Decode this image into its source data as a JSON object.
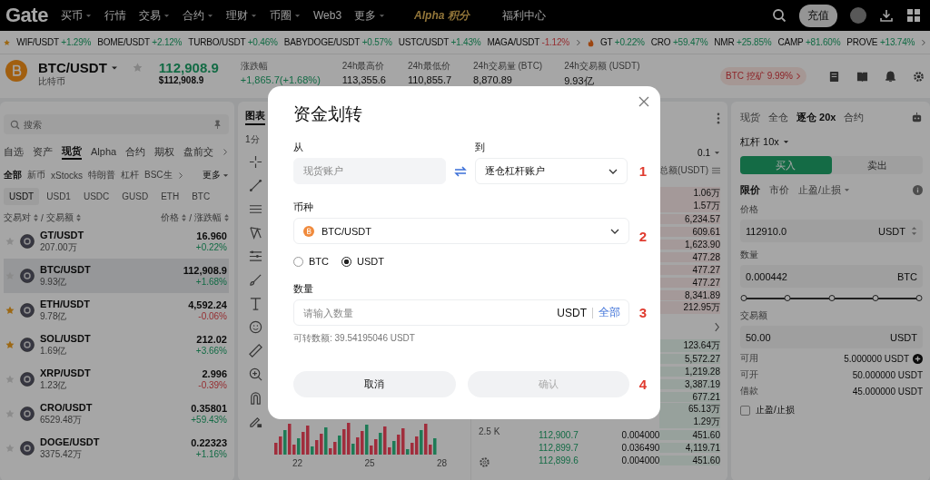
{
  "nav": {
    "logo": "Gate",
    "items": [
      {
        "label": "买币",
        "caret": true
      },
      {
        "label": "行情",
        "caret": false
      },
      {
        "label": "交易",
        "caret": true
      },
      {
        "label": "合约",
        "caret": true
      },
      {
        "label": "理财",
        "caret": true
      },
      {
        "label": "币圈",
        "caret": true
      },
      {
        "label": "Web3",
        "caret": false
      },
      {
        "label": "更多",
        "caret": true
      }
    ],
    "alpha": "Alpha 积分",
    "welfare": "福利中心",
    "deposit": "充值"
  },
  "ticker": {
    "left": [
      {
        "symbol": "WIF/USDT",
        "change": "+1.29%",
        "up": true
      },
      {
        "symbol": "BOME/USDT",
        "change": "+2.12%",
        "up": true
      },
      {
        "symbol": "TURBO/USDT",
        "change": "+0.46%",
        "up": true
      },
      {
        "symbol": "BABYDOGE/USDT",
        "change": "+0.57%",
        "up": true
      },
      {
        "symbol": "USTC/USDT",
        "change": "+1.43%",
        "up": true
      },
      {
        "symbol": "MAGA/USDT",
        "change": "-1.12%",
        "up": false
      }
    ],
    "right": [
      {
        "symbol": "GT",
        "change": "+0.22%",
        "up": true
      },
      {
        "symbol": "CRO",
        "change": "+59.47%",
        "up": true
      },
      {
        "symbol": "NMR",
        "change": "+25.85%",
        "up": true
      },
      {
        "symbol": "CAMP",
        "change": "+81.60%",
        "up": true
      },
      {
        "symbol": "PROVE",
        "change": "+13.74%",
        "up": true
      }
    ]
  },
  "pair_header": {
    "symbol": "BTC/USDT",
    "name": "比特币",
    "price": "112,908.9",
    "price_usd": "$112,908.9",
    "stats": [
      {
        "kind": "change",
        "label": "涨跌幅",
        "value": "+1,865.7(+1.68%)"
      },
      {
        "kind": "plain",
        "label": "24h最高价",
        "value": "113,355.6"
      },
      {
        "kind": "plain",
        "label": "24h最低价",
        "value": "110,855.7"
      },
      {
        "kind": "plain",
        "label": "24h交易量 (BTC)",
        "value": "8,870.89"
      },
      {
        "kind": "plain",
        "label": "24h交易额 (USDT)",
        "value": "9.93亿"
      }
    ],
    "promo": "BTC 挖矿 9.99%"
  },
  "markets": {
    "search": {
      "placeholder": "搜索"
    },
    "tabs": [
      {
        "label": "自选",
        "selected": false
      },
      {
        "label": "资产",
        "selected": false
      },
      {
        "label": "现货",
        "selected": true
      },
      {
        "label": "Alpha",
        "selected": false
      },
      {
        "label": "合约",
        "selected": false
      },
      {
        "label": "期权",
        "selected": false
      },
      {
        "label": "盘前交",
        "selected": false
      }
    ],
    "filters": [
      {
        "label": "全部",
        "selected": true
      },
      {
        "label": "新币",
        "selected": false
      },
      {
        "label": "xStocks",
        "selected": false
      },
      {
        "label": "特朗普",
        "selected": false
      },
      {
        "label": "杠杆",
        "selected": false
      },
      {
        "label": "BSC生",
        "selected": false
      }
    ],
    "more": "更多",
    "quotes": [
      {
        "label": "USDT",
        "selected": true
      },
      {
        "label": "USD1",
        "selected": false
      },
      {
        "label": "USDC",
        "selected": false
      },
      {
        "label": "GUSD",
        "selected": false
      },
      {
        "label": "ETH",
        "selected": false
      },
      {
        "label": "BTC",
        "selected": false
      }
    ],
    "columns": [
      "交易对",
      "交易额",
      "价格",
      "涨跌幅"
    ],
    "separator": "/",
    "rows": [
      {
        "pair": "GT/USDT",
        "volume": "207.00万",
        "price": "16.960",
        "change": "+0.22%",
        "up": true,
        "favorite": false,
        "selected": false
      },
      {
        "pair": "BTC/USDT",
        "volume": "9.93亿",
        "price": "112,908.9",
        "change": "+1.68%",
        "up": true,
        "favorite": false,
        "selected": true
      },
      {
        "pair": "ETH/USDT",
        "volume": "9.78亿",
        "price": "4,592.24",
        "change": "-0.06%",
        "up": false,
        "favorite": true,
        "selected": false
      },
      {
        "pair": "SOL/USDT",
        "volume": "1.69亿",
        "price": "212.02",
        "change": "+3.66%",
        "up": true,
        "favorite": true,
        "selected": false
      },
      {
        "pair": "XRP/USDT",
        "volume": "1.23亿",
        "price": "2.996",
        "change": "-0.39%",
        "up": false,
        "favorite": false,
        "selected": false
      },
      {
        "pair": "CRO/USDT",
        "volume": "6529.48万",
        "price": "0.35801",
        "change": "+59.43%",
        "up": true,
        "favorite": false,
        "selected": false
      },
      {
        "pair": "DOGE/USDT",
        "volume": "3375.42万",
        "price": "0.22323",
        "change": "+1.16%",
        "up": true,
        "favorite": false,
        "selected": false
      }
    ]
  },
  "chart": {
    "tab": "图表",
    "interval": "1分",
    "volume_tick": "2.5 K",
    "dates": [
      "22",
      "25",
      "28"
    ]
  },
  "order_book": {
    "step": "0.1",
    "total_header": "总额(USDT)",
    "asks": [
      {
        "total": "1.06万"
      },
      {
        "total": "1.57万"
      },
      {
        "total": "6,234.57"
      },
      {
        "total": "609.61"
      },
      {
        "total": "1,623.90"
      },
      {
        "total": "477.28"
      },
      {
        "total": "477.27"
      },
      {
        "total": "477.27"
      },
      {
        "total": "8,341.89"
      },
      {
        "total": "212.95万"
      }
    ],
    "bids": [
      {
        "total": "123.64万"
      },
      {
        "total": "5,572.27"
      },
      {
        "total": "1,219.28"
      },
      {
        "total": "3,387.19"
      },
      {
        "total": "677.21"
      },
      {
        "total": "65.13万"
      },
      {
        "total": "1.29万"
      },
      {
        "price": "112,900.7",
        "amount": "0.004000",
        "total": "451.60"
      },
      {
        "price": "112,899.7",
        "amount": "0.036490",
        "total": "4,119.71"
      },
      {
        "price": "112,899.6",
        "amount": "0.004000",
        "total": "451.60"
      }
    ]
  },
  "trade": {
    "tabs": [
      {
        "label": "现货",
        "selected": false
      },
      {
        "label": "全仓",
        "selected": false
      },
      {
        "label": "逐仓 20x",
        "selected": true
      },
      {
        "label": "合约",
        "selected": false
      }
    ],
    "leverage": "杠杆 10x",
    "sides": [
      {
        "label": "买入",
        "selected": true
      },
      {
        "label": "卖出",
        "selected": false
      }
    ],
    "order_types": [
      {
        "label": "限价",
        "selected": true,
        "caret": false
      },
      {
        "label": "市价",
        "selected": false,
        "caret": false
      },
      {
        "label": "止盈/止损",
        "selected": false,
        "caret": true
      }
    ],
    "fields": [
      {
        "label": "价格",
        "value": "112910.0",
        "unit": "USDT",
        "stepper": true
      },
      {
        "label": "数量",
        "value": "0.000442",
        "unit": "BTC",
        "stepper": false
      }
    ],
    "slider": {
      "level": 1
    },
    "total_field": {
      "label": "交易额",
      "value": "50.00",
      "unit": "USDT"
    },
    "balances": [
      {
        "label": "可用",
        "value": "5.000000 USDT",
        "add": true
      },
      {
        "label": "可开",
        "value": "50.000000 USDT",
        "add": false
      },
      {
        "label": "借款",
        "value": "45.000000 USDT",
        "add": false
      }
    ],
    "tpsl": {
      "label": "止盈/止损",
      "checked": false
    }
  },
  "transfer_dialog": {
    "title": "资金划转",
    "from": {
      "label": "从",
      "value": "现货账户",
      "disabled": true
    },
    "to": {
      "label": "到",
      "value": "逐仓杠杆账户"
    },
    "currency": {
      "label": "币种",
      "value": "BTC/USDT"
    },
    "units": [
      {
        "label": "BTC",
        "selected": false
      },
      {
        "label": "USDT",
        "selected": true
      }
    ],
    "amount": {
      "label": "数量",
      "placeholder": "请输入数量",
      "unit": "USDT",
      "all": "全部"
    },
    "available": "可转数额: 39.54195046 USDT",
    "buttons": [
      {
        "label": "取消",
        "disabled": false
      },
      {
        "label": "确认",
        "disabled": true
      }
    ],
    "steps": [
      "1",
      "2",
      "3",
      "4"
    ]
  }
}
